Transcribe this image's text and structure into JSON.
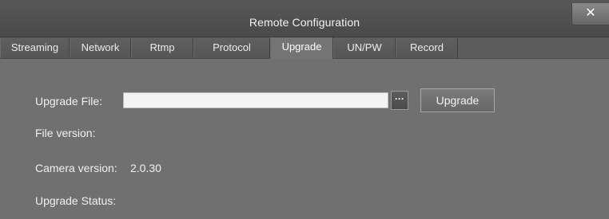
{
  "window": {
    "title": "Remote Configuration",
    "close_label": "✕"
  },
  "tabs": [
    {
      "label": "Streaming",
      "active": false
    },
    {
      "label": "Network",
      "active": false
    },
    {
      "label": "Rtmp",
      "active": false
    },
    {
      "label": "Protocol",
      "active": false
    },
    {
      "label": "Upgrade",
      "active": true
    },
    {
      "label": "UN/PW",
      "active": false
    },
    {
      "label": "Record",
      "active": false
    }
  ],
  "upgrade": {
    "file_label": "Upgrade File:",
    "file_value": "",
    "browse_label": "···",
    "upgrade_button_label": "Upgrade",
    "file_version_label": "File version:",
    "file_version_value": "",
    "camera_version_label": "Camera version:",
    "camera_version_value": "2.0.30",
    "status_label": "Upgrade Status:",
    "status_value": ""
  },
  "colors": {
    "window_bg": "#707070",
    "titlebar_bg": "#4f4f4f",
    "tab_bg": "#5b5b5b",
    "active_tab_bg": "#747474",
    "text": "#f0f0f0",
    "input_bg": "#f3f3f3"
  },
  "icons": {
    "close": "close-icon",
    "browse": "ellipsis-icon"
  }
}
